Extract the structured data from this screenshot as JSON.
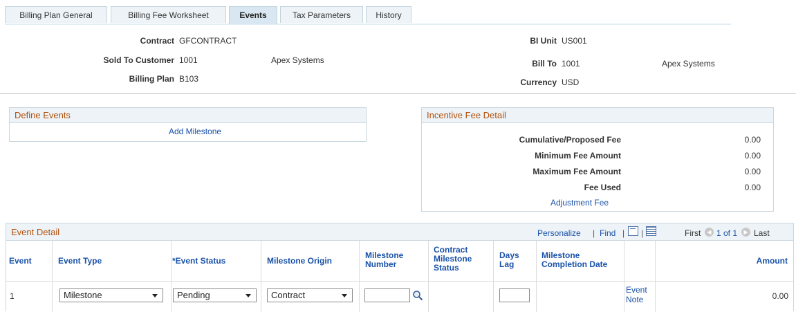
{
  "tabs": [
    {
      "label": "Billing Plan General"
    },
    {
      "label": "Billing Fee Worksheet"
    },
    {
      "label": "Events"
    },
    {
      "label": "Tax Parameters"
    },
    {
      "label": "History"
    }
  ],
  "header": {
    "contract_label": "Contract",
    "contract_value": "GFCONTRACT",
    "sold_to_label": "Sold To Customer",
    "sold_to_value": "1001",
    "sold_to_name": "Apex Systems",
    "billing_plan_label": "Billing Plan",
    "billing_plan_value": "B103",
    "bi_unit_label": "BI Unit",
    "bi_unit_value": "US001",
    "bill_to_label": "Bill To",
    "bill_to_value": "1001",
    "bill_to_name": "Apex Systems",
    "currency_label": "Currency",
    "currency_value": "USD"
  },
  "define_events": {
    "title": "Define Events",
    "add_milestone": "Add Milestone"
  },
  "incentive_fee": {
    "title": "Incentive Fee Detail",
    "rows": [
      {
        "label": "Cumulative/Proposed Fee",
        "value": "0.00"
      },
      {
        "label": "Minimum Fee Amount",
        "value": "0.00"
      },
      {
        "label": "Maximum Fee Amount",
        "value": "0.00"
      },
      {
        "label": "Fee Used",
        "value": "0.00"
      }
    ],
    "adjustment_link": "Adjustment Fee"
  },
  "event_detail": {
    "title": "Event Detail",
    "personalize": "Personalize",
    "sep1": "|",
    "find": "Find",
    "sep2": "|",
    "sep3": "|",
    "first": "First",
    "range": "1 of 1",
    "last": "Last",
    "columns": {
      "event": "Event",
      "event_type": "Event Type",
      "event_status": "*Event Status",
      "milestone_origin": "Milestone Origin",
      "milestone_number": "Milestone Number",
      "contract_milestone_status": "Contract Milestone Status",
      "days_lag": "Days Lag",
      "milestone_completion_date": "Milestone Completion Date",
      "amount": "Amount"
    },
    "row": {
      "event": "1",
      "event_type": "Milestone",
      "event_status": "Pending",
      "milestone_origin": "Contract",
      "milestone_number": "",
      "days_lag": "",
      "event_note": "Event Note",
      "amount": "0.00"
    }
  },
  "colors": {
    "section_title": "#b2500c",
    "link": "#1a52a8",
    "header_bg": "#edf3f7"
  }
}
